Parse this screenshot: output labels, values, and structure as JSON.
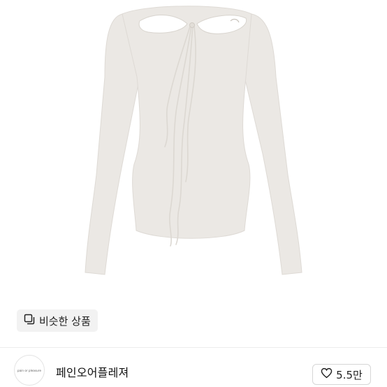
{
  "product": {
    "image_alt_icon": "product-photo",
    "colors": {
      "garment": "#ebe8e4",
      "background": "#ffffff"
    }
  },
  "similar_button": {
    "label": "비슷한 상품",
    "icon": "similar-items-icon"
  },
  "shop": {
    "name": "페인오어플레져",
    "avatar_text": "pain or pleasure"
  },
  "like": {
    "count": "5.5만",
    "icon": "heart-outline-icon"
  }
}
